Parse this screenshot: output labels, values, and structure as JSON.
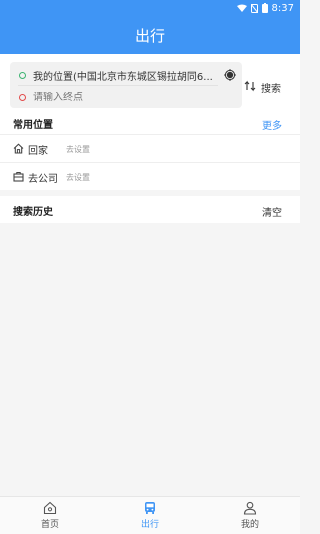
{
  "status_bar": {
    "time": "8:37"
  },
  "app_bar": {
    "title": "出行"
  },
  "route": {
    "origin": "我的位置(中国北京市东城区锡拉胡同6...",
    "destination_placeholder": "请输入终点",
    "search_label": "搜索"
  },
  "favorites": {
    "title": "常用位置",
    "more_label": "更多",
    "items": [
      {
        "label": "回家",
        "status": "去设置",
        "icon": "home-icon"
      },
      {
        "label": "去公司",
        "status": "去设置",
        "icon": "briefcase-icon"
      }
    ]
  },
  "history": {
    "title": "搜索历史",
    "clear_label": "清空"
  },
  "bottom_nav": {
    "items": [
      {
        "label": "首页",
        "icon": "home-icon",
        "active": false
      },
      {
        "label": "出行",
        "icon": "bus-icon",
        "active": true
      },
      {
        "label": "我的",
        "icon": "profile-icon",
        "active": false
      }
    ]
  },
  "colors": {
    "primary": "#3f95f5",
    "origin_dot": "#3cb371",
    "destination_dot": "#e24a4a"
  }
}
